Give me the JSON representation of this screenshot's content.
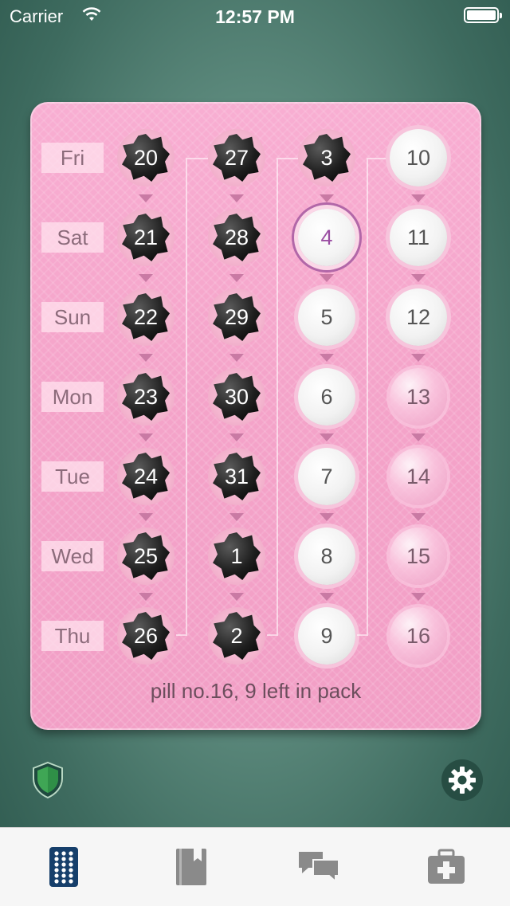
{
  "status_bar": {
    "carrier": "Carrier",
    "time": "12:57 PM"
  },
  "pack": {
    "days": [
      "Fri",
      "Sat",
      "Sun",
      "Mon",
      "Tue",
      "Wed",
      "Thu"
    ],
    "columns": [
      [
        {
          "n": "20",
          "state": "taken"
        },
        {
          "n": "21",
          "state": "taken"
        },
        {
          "n": "22",
          "state": "taken"
        },
        {
          "n": "23",
          "state": "taken"
        },
        {
          "n": "24",
          "state": "taken"
        },
        {
          "n": "25",
          "state": "taken"
        },
        {
          "n": "26",
          "state": "taken"
        }
      ],
      [
        {
          "n": "27",
          "state": "taken"
        },
        {
          "n": "28",
          "state": "taken"
        },
        {
          "n": "29",
          "state": "taken"
        },
        {
          "n": "30",
          "state": "taken"
        },
        {
          "n": "31",
          "state": "taken"
        },
        {
          "n": "1",
          "state": "taken"
        },
        {
          "n": "2",
          "state": "taken"
        }
      ],
      [
        {
          "n": "3",
          "state": "taken"
        },
        {
          "n": "4",
          "state": "today"
        },
        {
          "n": "5",
          "state": "active"
        },
        {
          "n": "6",
          "state": "active"
        },
        {
          "n": "7",
          "state": "active"
        },
        {
          "n": "8",
          "state": "active"
        },
        {
          "n": "9",
          "state": "active"
        }
      ],
      [
        {
          "n": "10",
          "state": "active"
        },
        {
          "n": "11",
          "state": "active"
        },
        {
          "n": "12",
          "state": "active"
        },
        {
          "n": "13",
          "state": "placebo"
        },
        {
          "n": "14",
          "state": "placebo"
        },
        {
          "n": "15",
          "state": "placebo"
        },
        {
          "n": "16",
          "state": "placebo"
        }
      ]
    ],
    "status_text": "pill no.16, 9 left in pack"
  },
  "icons": {
    "shield": "shield-icon",
    "settings": "gear-icon"
  },
  "tab_bar": {
    "tabs": [
      {
        "icon": "pill-pack-icon",
        "selected": true
      },
      {
        "icon": "book-icon",
        "selected": false
      },
      {
        "icon": "chat-icon",
        "selected": false
      },
      {
        "icon": "medical-kit-icon",
        "selected": false
      }
    ]
  },
  "colors": {
    "accent": "#163f6b",
    "today_ring": "#b267a8",
    "shield": "#3fa655",
    "pack_pink": "#f4a3c9"
  }
}
